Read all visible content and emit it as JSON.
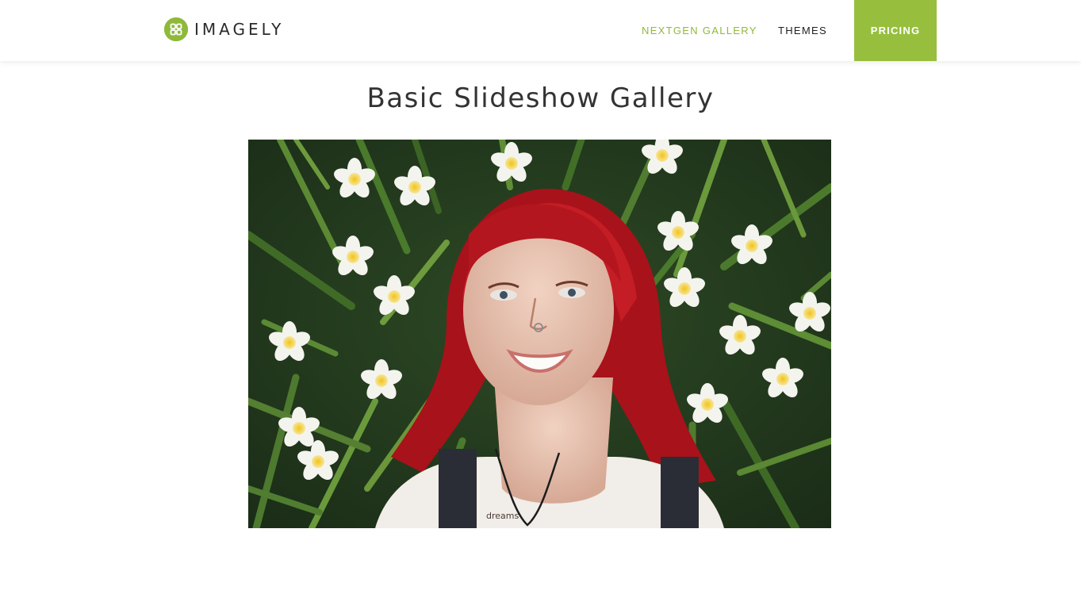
{
  "brand": {
    "name": "IMAGELY",
    "accent": "#97bf3d",
    "icon": "grid-logo-icon"
  },
  "nav": {
    "items": [
      {
        "label": "NEXTGEN GALLERY",
        "active": true
      },
      {
        "label": "THEMES",
        "active": false
      }
    ],
    "cta_label": "PRICING"
  },
  "main": {
    "title": "Basic Slideshow Gallery",
    "slide": {
      "alt": "Photo of a smiling red-haired woman lying in grass surrounded by white plumeria flowers",
      "tattoo_text": "dreams"
    }
  }
}
